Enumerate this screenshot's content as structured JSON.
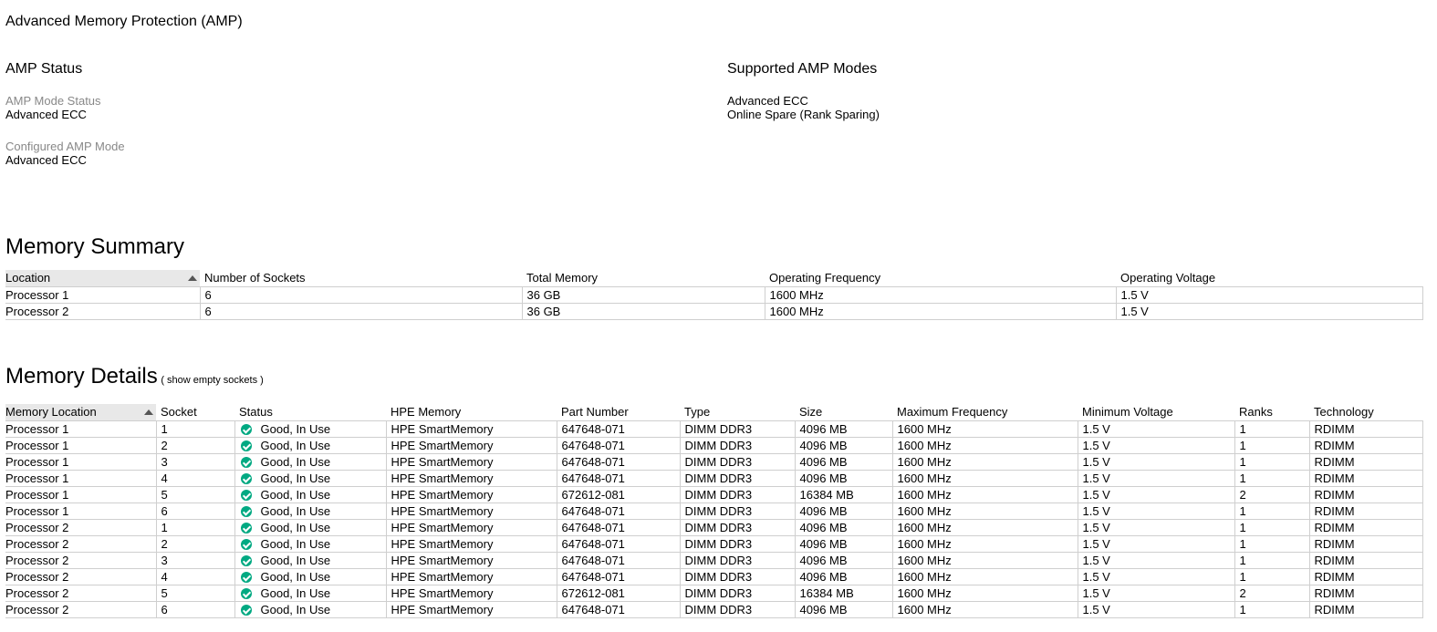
{
  "page_title": "Advanced Memory Protection (AMP)",
  "amp_status": {
    "heading": "AMP Status",
    "mode_status_label": "AMP Mode Status",
    "mode_status_value": "Advanced ECC",
    "configured_label": "Configured AMP Mode",
    "configured_value": "Advanced ECC"
  },
  "supported_modes": {
    "heading": "Supported AMP Modes",
    "modes": [
      "Advanced ECC",
      "Online Spare (Rank Sparing)"
    ]
  },
  "memory_summary": {
    "heading": "Memory Summary",
    "columns": [
      "Location",
      "Number of Sockets",
      "Total Memory",
      "Operating Frequency",
      "Operating Voltage"
    ],
    "rows": [
      [
        "Processor 1",
        "6",
        "36 GB",
        "1600 MHz",
        "1.5 V"
      ],
      [
        "Processor 2",
        "6",
        "36 GB",
        "1600 MHz",
        "1.5 V"
      ]
    ]
  },
  "memory_details": {
    "heading": "Memory Details",
    "show_empty_link": "( show empty sockets )",
    "columns": [
      "Memory Location",
      "Socket",
      "Status",
      "HPE Memory",
      "Part Number",
      "Type",
      "Size",
      "Maximum Frequency",
      "Minimum Voltage",
      "Ranks",
      "Technology"
    ],
    "status_icon": "check-circle-icon",
    "status_color": "#01a982",
    "rows": [
      [
        "Processor 1",
        "1",
        "Good, In Use",
        "HPE SmartMemory",
        "647648-071",
        "DIMM DDR3",
        "4096 MB",
        "1600 MHz",
        "1.5 V",
        "1",
        "RDIMM"
      ],
      [
        "Processor 1",
        "2",
        "Good, In Use",
        "HPE SmartMemory",
        "647648-071",
        "DIMM DDR3",
        "4096 MB",
        "1600 MHz",
        "1.5 V",
        "1",
        "RDIMM"
      ],
      [
        "Processor 1",
        "3",
        "Good, In Use",
        "HPE SmartMemory",
        "647648-071",
        "DIMM DDR3",
        "4096 MB",
        "1600 MHz",
        "1.5 V",
        "1",
        "RDIMM"
      ],
      [
        "Processor 1",
        "4",
        "Good, In Use",
        "HPE SmartMemory",
        "647648-071",
        "DIMM DDR3",
        "4096 MB",
        "1600 MHz",
        "1.5 V",
        "1",
        "RDIMM"
      ],
      [
        "Processor 1",
        "5",
        "Good, In Use",
        "HPE SmartMemory",
        "672612-081",
        "DIMM DDR3",
        "16384 MB",
        "1600 MHz",
        "1.5 V",
        "2",
        "RDIMM"
      ],
      [
        "Processor 1",
        "6",
        "Good, In Use",
        "HPE SmartMemory",
        "647648-071",
        "DIMM DDR3",
        "4096 MB",
        "1600 MHz",
        "1.5 V",
        "1",
        "RDIMM"
      ],
      [
        "Processor 2",
        "1",
        "Good, In Use",
        "HPE SmartMemory",
        "647648-071",
        "DIMM DDR3",
        "4096 MB",
        "1600 MHz",
        "1.5 V",
        "1",
        "RDIMM"
      ],
      [
        "Processor 2",
        "2",
        "Good, In Use",
        "HPE SmartMemory",
        "647648-071",
        "DIMM DDR3",
        "4096 MB",
        "1600 MHz",
        "1.5 V",
        "1",
        "RDIMM"
      ],
      [
        "Processor 2",
        "3",
        "Good, In Use",
        "HPE SmartMemory",
        "647648-071",
        "DIMM DDR3",
        "4096 MB",
        "1600 MHz",
        "1.5 V",
        "1",
        "RDIMM"
      ],
      [
        "Processor 2",
        "4",
        "Good, In Use",
        "HPE SmartMemory",
        "647648-071",
        "DIMM DDR3",
        "4096 MB",
        "1600 MHz",
        "1.5 V",
        "1",
        "RDIMM"
      ],
      [
        "Processor 2",
        "5",
        "Good, In Use",
        "HPE SmartMemory",
        "672612-081",
        "DIMM DDR3",
        "16384 MB",
        "1600 MHz",
        "1.5 V",
        "2",
        "RDIMM"
      ],
      [
        "Processor 2",
        "6",
        "Good, In Use",
        "HPE SmartMemory",
        "647648-071",
        "DIMM DDR3",
        "4096 MB",
        "1600 MHz",
        "1.5 V",
        "1",
        "RDIMM"
      ]
    ]
  }
}
